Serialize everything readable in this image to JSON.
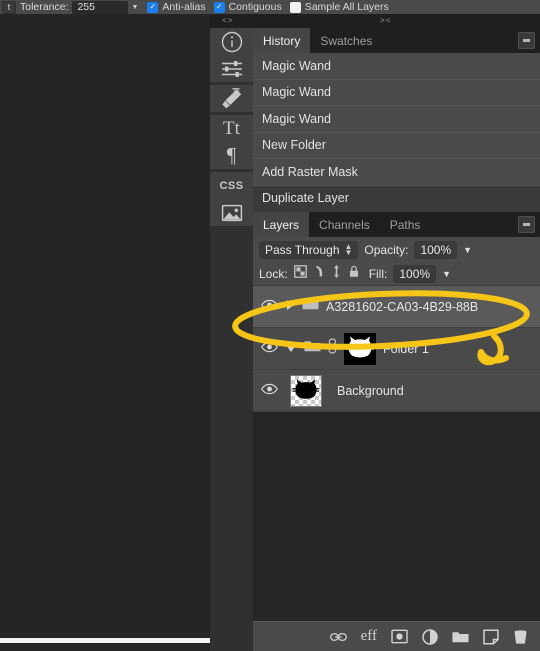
{
  "toolbar": {
    "tool_button": "t",
    "tolerance_label": "Tolerance:",
    "tolerance_value": "255",
    "antialias_label": "Anti-alias",
    "antialias_checked": "✓",
    "contiguous_label": "Contiguous",
    "contiguous_checked": "✓",
    "sample_all_layers_label": "Sample All Layers",
    "sample_all_layers_checked": ""
  },
  "studio": {
    "collapse_left": "<>",
    "collapse_right": "><"
  },
  "icon_rail": {
    "items": [
      {
        "name": "info-icon",
        "label": "i"
      },
      {
        "name": "adjustments-icon",
        "label": ""
      },
      {
        "name": "brush-icon",
        "label": ""
      },
      {
        "name": "text-icon",
        "label": "Tt"
      },
      {
        "name": "paragraph-icon",
        "label": "¶"
      },
      {
        "name": "css-icon",
        "label": "CSS"
      },
      {
        "name": "image-icon",
        "label": ""
      }
    ]
  },
  "history_panel": {
    "tabs": [
      {
        "label": "History",
        "active": true
      },
      {
        "label": "Swatches",
        "active": false
      }
    ],
    "menu_button": "≡",
    "entries": [
      {
        "label": "Magic Wand",
        "selected": false
      },
      {
        "label": "Magic Wand",
        "selected": false
      },
      {
        "label": "Magic Wand",
        "selected": false
      },
      {
        "label": "New Folder",
        "selected": false
      },
      {
        "label": "Add Raster Mask",
        "selected": false
      },
      {
        "label": "Duplicate Layer",
        "selected": true
      }
    ]
  },
  "layers_panel": {
    "tabs": [
      {
        "label": "Layers",
        "active": true
      },
      {
        "label": "Channels",
        "active": false
      },
      {
        "label": "Paths",
        "active": false
      }
    ],
    "menu_button": "≡",
    "blend_mode": "Pass Through",
    "opacity_label": "Opacity:",
    "opacity_value": "100%",
    "lock_label": "Lock:",
    "fill_label": "Fill:",
    "fill_value": "100%",
    "layers": [
      {
        "name": "A3281602-CA03-4B29-88B",
        "selected": true,
        "visible": true,
        "expanded": false,
        "kind": "folder",
        "has_thumb": false,
        "has_link": false
      },
      {
        "name": "Folder 1",
        "selected": false,
        "visible": true,
        "expanded": true,
        "kind": "folder",
        "has_thumb": true,
        "thumb_style": "mask-white-cat",
        "has_link": true
      },
      {
        "name": "Background",
        "selected": false,
        "visible": true,
        "expanded": null,
        "kind": "pixel",
        "has_thumb": true,
        "thumb_style": "checker-black-cat",
        "has_link": false
      }
    ],
    "bottom_tools": [
      {
        "name": "link-layers-icon",
        "label": "link"
      },
      {
        "name": "layer-effects-icon",
        "label": "eff"
      },
      {
        "name": "mask-layer-icon",
        "label": "mask"
      },
      {
        "name": "adjustment-layer-icon",
        "label": "adjustment"
      },
      {
        "name": "new-group-icon",
        "label": "group"
      },
      {
        "name": "new-layer-icon",
        "label": "new-layer"
      },
      {
        "name": "delete-layer-icon",
        "label": "trash"
      }
    ]
  },
  "annotation": {
    "color": "#F5C518",
    "shapes": "ellipse-around-selected-layer-and-arrow"
  },
  "colors": {
    "panel_bg": "#4a4a4a",
    "tabbar_bg": "#1f1f1f",
    "canvas_bg": "#252525",
    "rail_bg": "#303030",
    "accent_blue": "#1a7ef0",
    "annotation_yellow": "#F5C518",
    "selected_row": "#5a5a5a"
  }
}
